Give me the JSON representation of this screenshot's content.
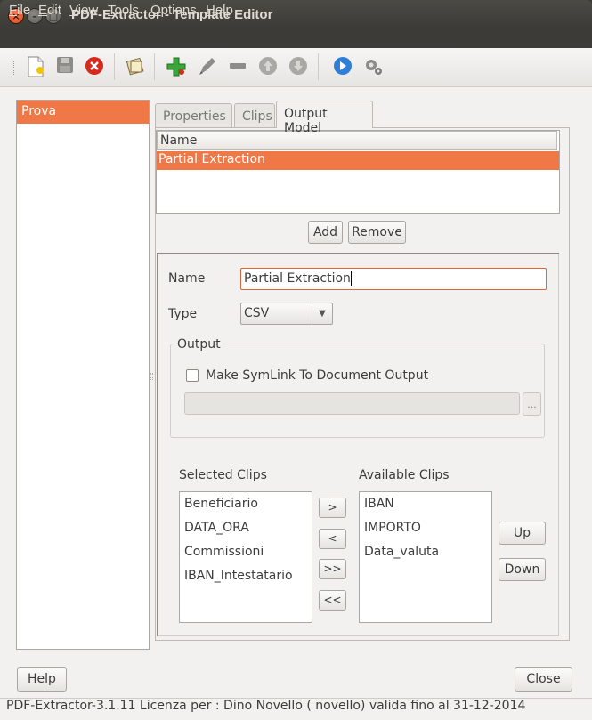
{
  "window": {
    "title": "PDF-Extractor - Template Editor",
    "close_glyph": "×",
    "min_glyph": "–",
    "max_glyph": "□"
  },
  "menu": [
    {
      "label": "File"
    },
    {
      "label": "Edit"
    },
    {
      "label": "View"
    },
    {
      "label": "Tools"
    },
    {
      "label": "Options"
    },
    {
      "label": "Help"
    }
  ],
  "toolbar": {
    "icons": [
      "new-document-icon",
      "save-icon",
      "cancel-icon",
      "open-template-icon",
      "add-icon",
      "edit-icon",
      "remove-icon",
      "move-up-icon",
      "move-down-icon",
      "run-icon",
      "settings-icon"
    ]
  },
  "templates": {
    "items": [
      {
        "label": "Prova"
      }
    ],
    "selected": "Prova"
  },
  "tabs": [
    {
      "label": "Properties"
    },
    {
      "label": "Clips"
    },
    {
      "label": "Output Model",
      "active": true
    }
  ],
  "output_models": {
    "column_header": "Name",
    "rows": [
      {
        "name": "Partial Extraction"
      }
    ],
    "add_label": "Add",
    "remove_label": "Remove"
  },
  "form": {
    "name_label": "Name",
    "name_value": "Partial Extraction",
    "type_label": "Type",
    "type_value": "CSV",
    "output_legend": "Output",
    "symlink_label": "Make SymLink To Document Output",
    "symlink_checked": false,
    "path_value": "",
    "browse_label": "..."
  },
  "clips": {
    "selected_title": "Selected Clips",
    "available_title": "Available Clips",
    "selected": [
      "Beneficiario",
      "DATA_ORA",
      "Commissioni",
      "IBAN_Intestatario"
    ],
    "available": [
      "IBAN",
      "IMPORTO",
      "Data_valuta"
    ],
    "move_right": ">",
    "move_left": "<",
    "move_all_right": ">>",
    "move_all_left": "<<",
    "up_label": "Up",
    "down_label": "Down"
  },
  "footer": {
    "help_label": "Help",
    "close_label": "Close",
    "status": "PDF-Extractor-3.1.11  Licenza per : Dino Novello ( novello) valida fino al 31-12-2014"
  },
  "colors": {
    "accent": "#f07746",
    "titlebar": "#3c3b37",
    "window_bg": "#f2f1f0"
  }
}
